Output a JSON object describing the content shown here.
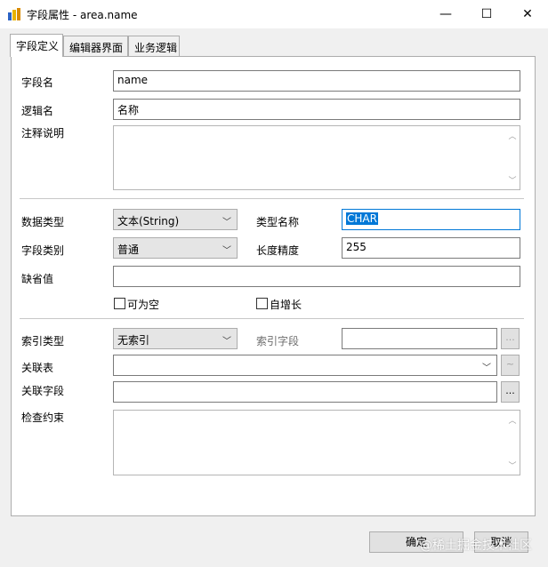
{
  "window": {
    "title": "字段属性 - area.name",
    "minimize_glyph": "—",
    "maximize_glyph": "☐",
    "close_glyph": "✕"
  },
  "tabs": [
    {
      "label": "字段定义",
      "active": true
    },
    {
      "label": "编辑器界面",
      "active": false
    },
    {
      "label": "业务逻辑",
      "active": false
    }
  ],
  "form": {
    "field_name_label": "字段名",
    "field_name_value": "name",
    "logic_name_label": "逻辑名",
    "logic_name_value": "名称",
    "comment_label": "注释说明",
    "comment_value": "",
    "data_type_label": "数据类型",
    "data_type_value": "文本(String)",
    "type_name_label": "类型名称",
    "type_name_value": "CHAR",
    "field_category_label": "字段类别",
    "field_category_value": "普通",
    "length_label": "长度精度",
    "length_value": "255",
    "default_label": "缺省值",
    "default_value": "",
    "nullable_label": "可为空",
    "nullable_checked": false,
    "autoinc_label": "自增长",
    "autoinc_checked": false,
    "index_type_label": "索引类型",
    "index_type_value": "无索引",
    "index_field_label": "索引字段",
    "index_field_value": "",
    "related_table_label": "关联表",
    "related_table_value": "",
    "related_field_label": "关联字段",
    "related_field_value": "",
    "check_label": "检查约束",
    "check_value": "",
    "ellipsis": "...",
    "tilde": "~"
  },
  "buttons": {
    "ok_label": "确定",
    "cancel_label": "取消"
  },
  "watermark": "@稀土掘金技术社区",
  "colors": {
    "selection": "#0078d7",
    "dialog_bg": "#f0f0f0",
    "app_icon_yellow": "#e8b200",
    "app_icon_blue": "#2b63c6"
  }
}
